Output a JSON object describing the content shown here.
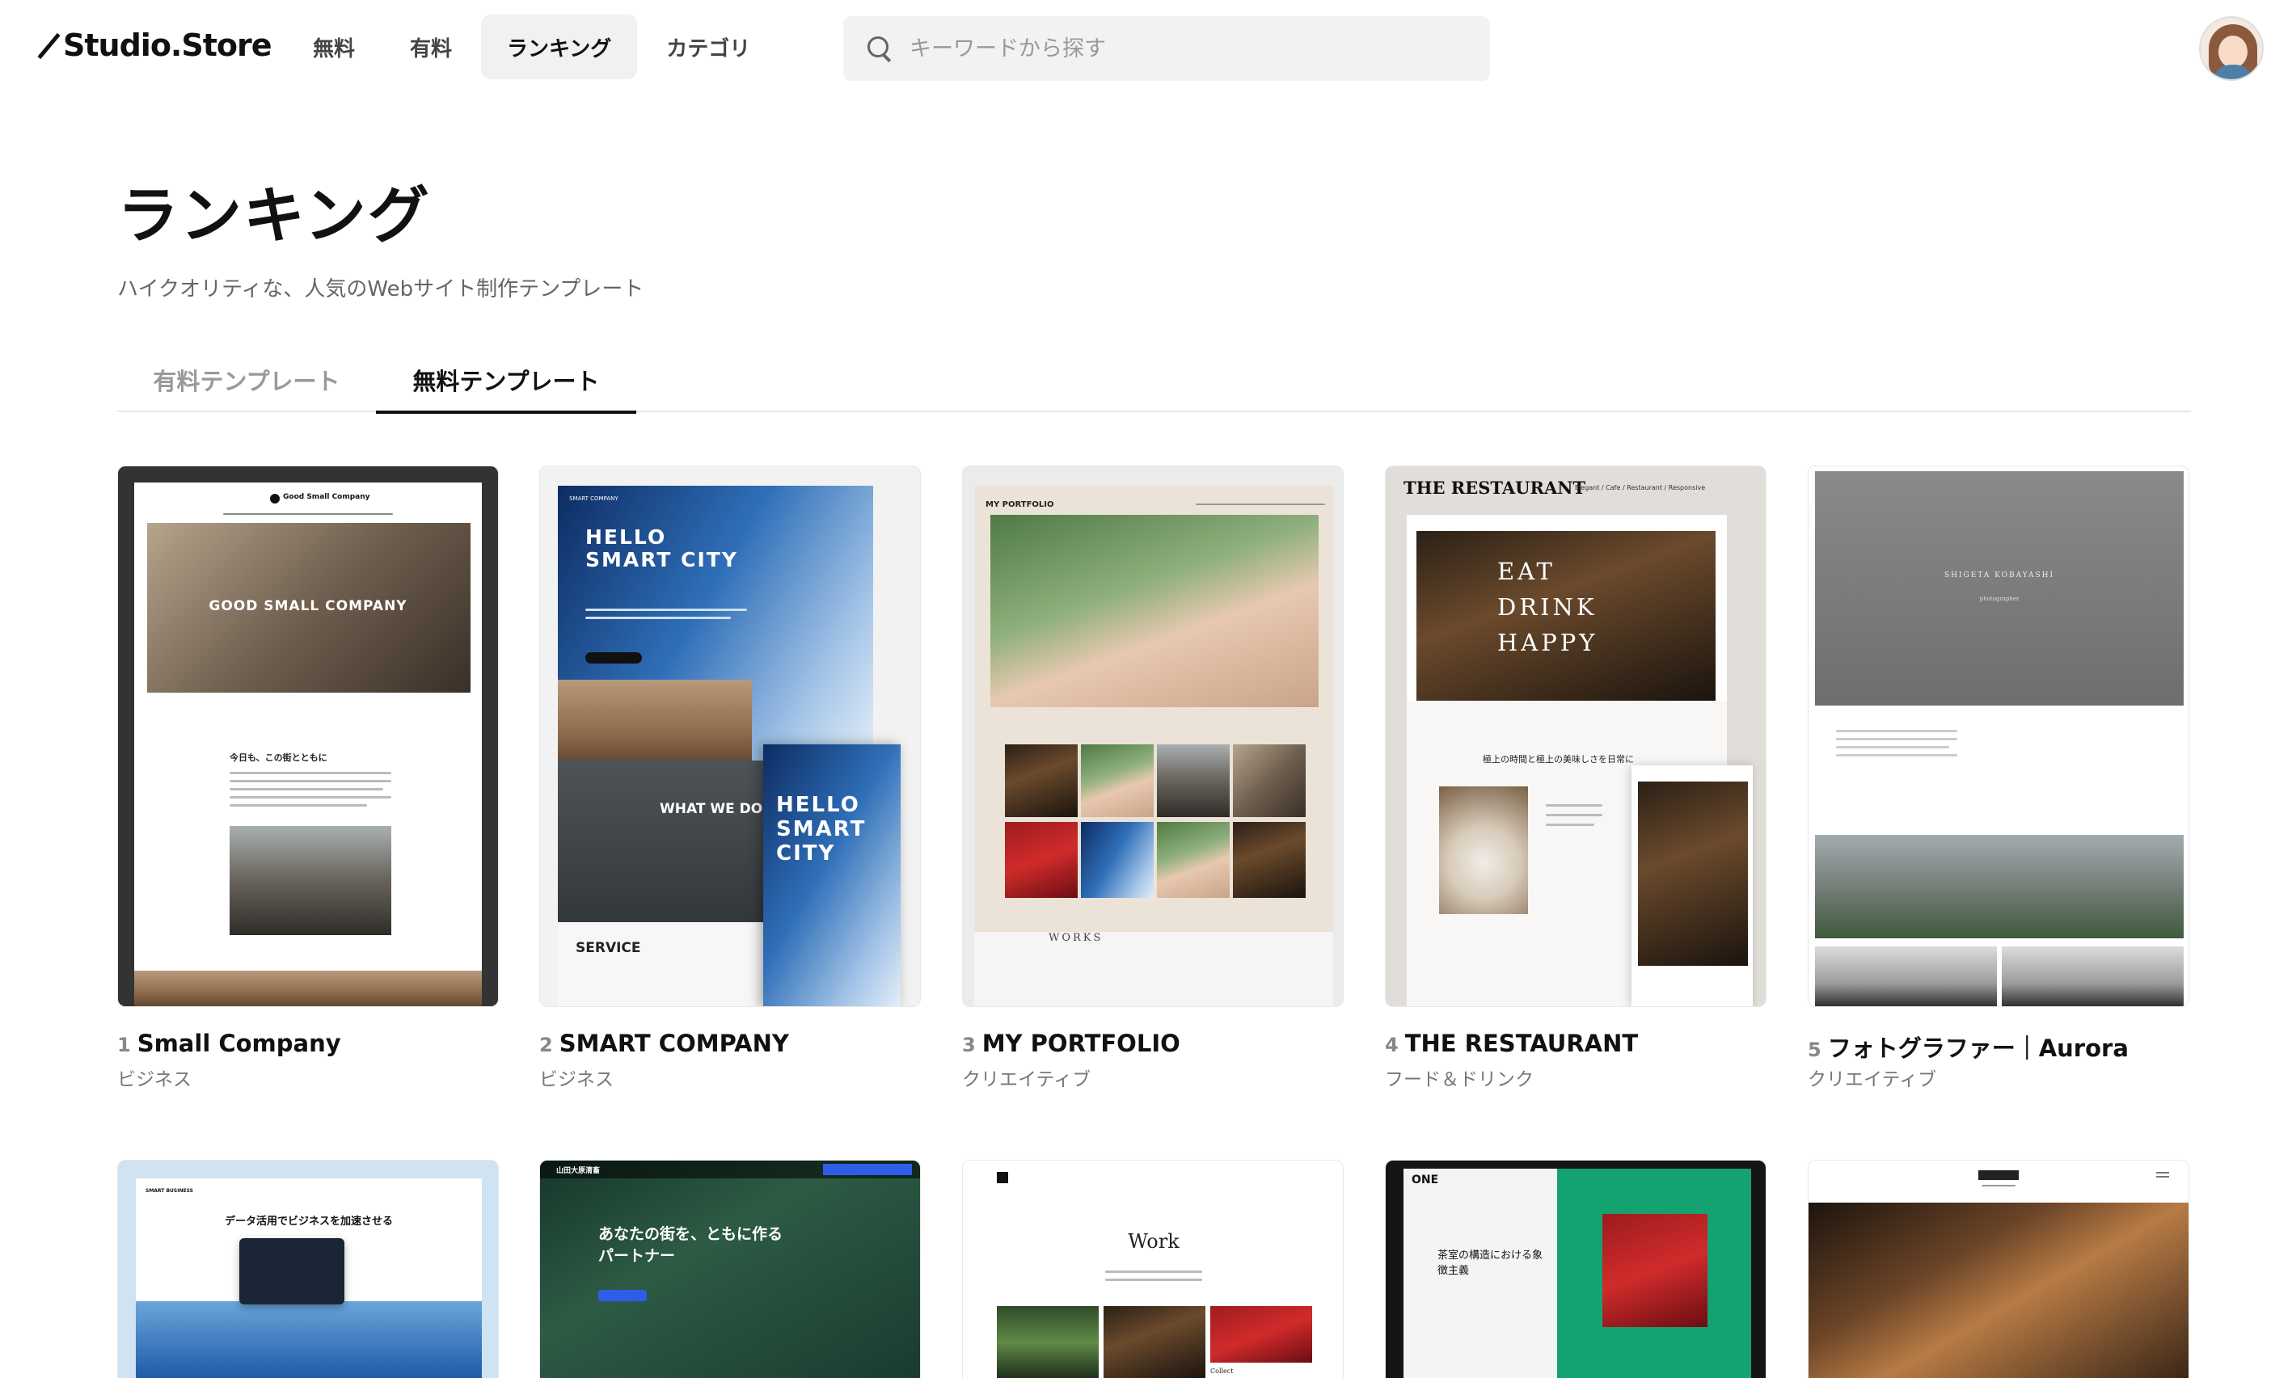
{
  "header": {
    "logo": "Studio.Store",
    "nav": [
      {
        "label": "無料",
        "active": false
      },
      {
        "label": "有料",
        "active": false
      },
      {
        "label": "ランキング",
        "active": true
      },
      {
        "label": "カテゴリ",
        "active": false
      }
    ],
    "search_placeholder": "キーワードから探す"
  },
  "page": {
    "title": "ランキング",
    "subtitle": "ハイクオリティな、人気のWebサイト制作テンプレート"
  },
  "tabs": [
    {
      "label": "有料テンプレート",
      "active": false
    },
    {
      "label": "無料テンプレート",
      "active": true
    }
  ],
  "templates": [
    {
      "rank": "1",
      "name": "Small Company",
      "category": "ビジネス",
      "preview": {
        "brand": "Good Small Company",
        "hero": "GOOD SMALL COMPANY",
        "heading": "今日も、この街とともに"
      }
    },
    {
      "rank": "2",
      "name": "SMART COMPANY",
      "category": "ビジネス",
      "preview": {
        "brand": "SMART COMPANY",
        "hero": "HELLO SMART CITY",
        "hero_mobile": "HELLO SMART CITY",
        "section1": "WHAT WE DO",
        "section2": "SERVICE"
      }
    },
    {
      "rank": "3",
      "name": "MY PORTFOLIO",
      "category": "クリエイティブ",
      "preview": {
        "brand": "MY PORTFOLIO",
        "section": "WORKS"
      }
    },
    {
      "rank": "4",
      "name": "THE RESTAURANT",
      "category": "フード＆ドリンク",
      "preview": {
        "brand": "THE RESTAURANT",
        "tagline": "Elegant / Cafe / Restaurant / Responsive",
        "hero": "EAT DRINK HAPPY",
        "heading": "極上の時間と極上の美味しさを日常に"
      }
    },
    {
      "rank": "5",
      "name": "フォトグラファー｜Aurora",
      "category": "クリエイティブ",
      "preview": {
        "brand": "SHIGETA KOBAYASHI",
        "sub": "photographer"
      }
    },
    {
      "preview": {
        "brand": "SMART BUSINESS",
        "heading": "データ活用でビジネスを加速させる"
      }
    },
    {
      "preview": {
        "brand": "山田大原清畜",
        "heading": "あなたの街を、ともに作るパートナー"
      }
    },
    {
      "preview": {
        "heading": "Work",
        "caption": "Collect"
      }
    },
    {
      "preview": {
        "brand": "ONE",
        "heading": "茶室の構造における象徴主義"
      }
    },
    {
      "preview": {}
    }
  ]
}
